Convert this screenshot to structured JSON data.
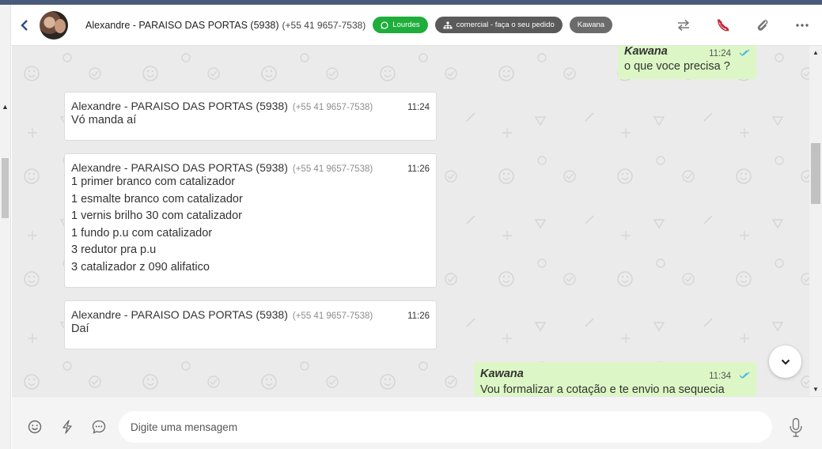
{
  "header": {
    "contact_name": "Alexandre - PARAISO DAS PORTAS (5938)",
    "contact_phone": "(+55 41 9657-7538)",
    "tags": [
      {
        "label": "Lourdes",
        "icon": "whatsapp-icon",
        "color": "#1fae3b"
      },
      {
        "label": "comercial - faça o seu pedido",
        "icon": "sitemap-icon",
        "color": "#5a5a5a"
      },
      {
        "label": "Kawana",
        "color": "#6b6b6b"
      }
    ],
    "actions": [
      "transfer-icon",
      "end-call-icon",
      "attach-icon",
      "more-icon"
    ]
  },
  "messages": {
    "out_top": {
      "sender": "Kawana",
      "time": "11:24",
      "text": "o que voce precisa ?"
    },
    "in": [
      {
        "author": "Alexandre - PARAISO DAS PORTAS (5938)",
        "phone": "(+55 41 9657-7538)",
        "time": "11:24",
        "lines": [
          "Vó manda aí"
        ]
      },
      {
        "author": "Alexandre - PARAISO DAS PORTAS (5938)",
        "phone": "(+55 41 9657-7538)",
        "time": "11:26",
        "lines": [
          "1 primer branco com catalizador",
          "1 esmalte branco com catalizador",
          "1 vernis brilho 30 com catalizador",
          "1 fundo p.u com catalizador",
          "3 redutor pra p.u",
          "3 catalizador z 090 alifatico"
        ]
      },
      {
        "author": "Alexandre - PARAISO DAS PORTAS (5938)",
        "phone": "(+55 41 9657-7538)",
        "time": "11:26",
        "lines": [
          "Daí"
        ]
      }
    ],
    "out_bottom": {
      "sender": "Kawana",
      "time": "11:34",
      "text": "Vou formalizar a cotação e te envio na sequecia"
    }
  },
  "composer": {
    "placeholder": "Digite uma mensagem",
    "icons": [
      "emoji-icon",
      "quick-reply-icon",
      "chat-bubble-icon",
      "microphone-icon"
    ]
  },
  "colors": {
    "outgoing": "#dcf7c5",
    "incoming": "#ffffff",
    "chat_bg": "#ebebeb",
    "accent_bar": "#4a5a7a"
  }
}
